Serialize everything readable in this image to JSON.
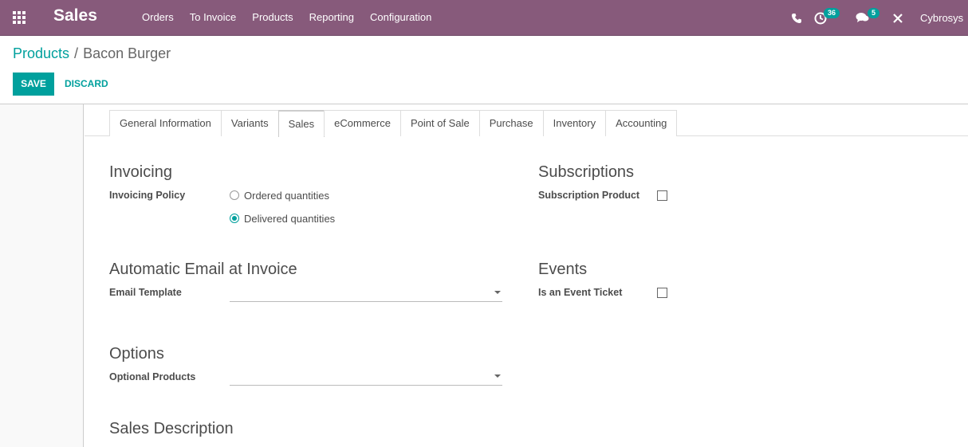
{
  "navbar": {
    "app_name": "Sales",
    "menu": [
      "Orders",
      "To Invoice",
      "Products",
      "Reporting",
      "Configuration"
    ],
    "activity_count": "36",
    "message_count": "5",
    "user": "Cybrosys"
  },
  "breadcrumb": {
    "parent": "Products",
    "separator": "/",
    "current": "Bacon Burger"
  },
  "buttons": {
    "save": "SAVE",
    "discard": "DISCARD"
  },
  "tabs": [
    "General Information",
    "Variants",
    "Sales",
    "eCommerce",
    "Point of Sale",
    "Purchase",
    "Inventory",
    "Accounting"
  ],
  "active_tab": "Sales",
  "invoicing": {
    "title": "Invoicing",
    "policy_label": "Invoicing Policy",
    "options": [
      "Ordered quantities",
      "Delivered quantities"
    ],
    "selected": "Delivered quantities"
  },
  "subscriptions": {
    "title": "Subscriptions",
    "label": "Subscription Product",
    "checked": false
  },
  "auto_email": {
    "title": "Automatic Email at Invoice",
    "label": "Email Template",
    "value": ""
  },
  "events": {
    "title": "Events",
    "label": "Is an Event Ticket",
    "checked": false
  },
  "options": {
    "title": "Options",
    "label": "Optional Products",
    "value": ""
  },
  "sales_description": {
    "title": "Sales Description"
  },
  "colors": {
    "brand": "#875a7b",
    "accent": "#00a09d"
  }
}
